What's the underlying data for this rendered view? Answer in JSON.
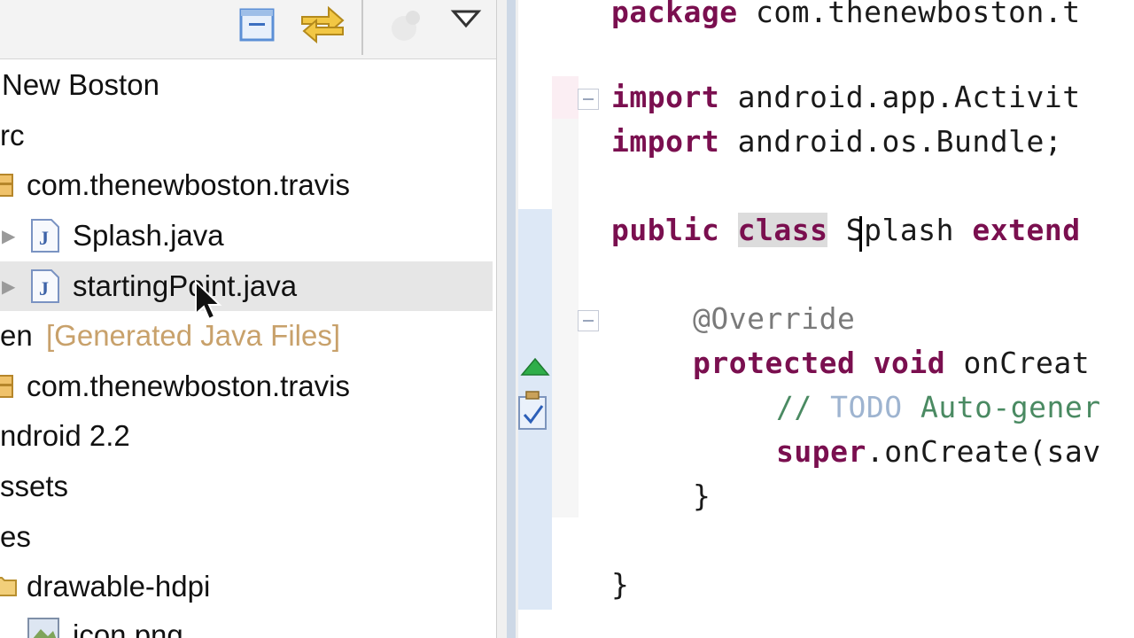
{
  "explorer": {
    "toolbar": {
      "collapse_all_icon": "collapse-all-icon",
      "link_editor_icon": "link-with-editor-icon",
      "disabled_icon": "disabled-tool-icon",
      "view_menu_icon": "view-menu-icon"
    },
    "tree": [
      {
        "label": "New Boston",
        "icon": "project-icon"
      },
      {
        "label": "rc",
        "icon": "src-folder-icon"
      },
      {
        "label": "com.thenewboston.travis",
        "icon": "package-icon"
      },
      {
        "label": "Splash.java",
        "icon": "java-file-icon"
      },
      {
        "label": "startingPoint.java",
        "icon": "java-file-icon"
      },
      {
        "label": "en",
        "suffix": "[Generated Java Files]",
        "icon": "gen-folder-icon"
      },
      {
        "label": "com.thenewboston.travis",
        "icon": "package-icon"
      },
      {
        "label": "ndroid 2.2",
        "icon": "library-icon"
      },
      {
        "label": "ssets",
        "icon": "folder-icon"
      },
      {
        "label": "es",
        "icon": "folder-icon"
      },
      {
        "label": "drawable-hdpi",
        "icon": "folder-icon"
      },
      {
        "label": "icon.png",
        "icon": "image-file-icon"
      }
    ]
  },
  "editor": {
    "lines": {
      "l1_kw": "package",
      "l1_rest": " com.thenewboston.t",
      "l2_kw": "import",
      "l2_rest": " android.app.Activit",
      "l3_kw": "import",
      "l3_rest": " android.os.Bundle;",
      "l4_kw": "public",
      "l4_sp": " ",
      "l4_kw2": "class",
      "l4_rest": " Splash ",
      "l4_kw3": "extend",
      "l5_anno": "@Override",
      "l6_kw": "protected",
      "l6_sp": " ",
      "l6_kw2": "void",
      "l6_rest": " onCreat",
      "l7_comment_pre": "// ",
      "l7_todo": "TODO",
      "l7_comment_rest": " Auto-gener",
      "l8_kw": "super",
      "l8_rest": ".onCreate(sav",
      "l9": "}",
      "l10": "}"
    },
    "ruler_icons": [
      "override-triangle-icon",
      "task-icon"
    ]
  },
  "colors": {
    "keyword": "#7a0f4f",
    "comment": "#4a8a62",
    "generated": "#c8a16b"
  }
}
